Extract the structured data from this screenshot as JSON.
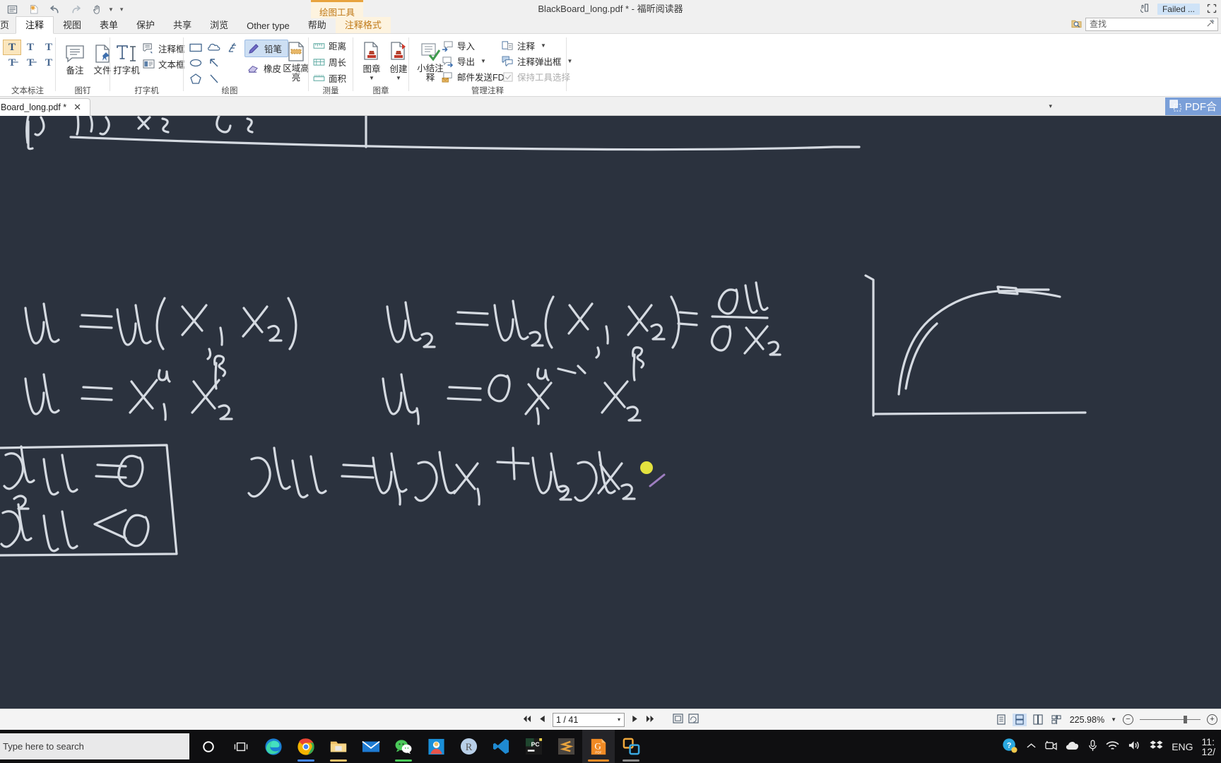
{
  "window": {
    "title": "BlackBoard_long.pdf * - 福昕阅读器",
    "contextual_tab": "绘图工具",
    "quick_access": [
      {
        "name": "save-icon",
        "glyph": "▤"
      },
      {
        "name": "new-document-icon",
        "glyph": "✳"
      },
      {
        "name": "undo-icon",
        "glyph": "↺"
      },
      {
        "name": "redo-icon",
        "glyph": "↻"
      },
      {
        "name": "hand-tool-icon",
        "glyph": "☞"
      }
    ],
    "top_right": {
      "hand_icon": "☝",
      "failed_label": "Failed ...",
      "restore_icon": "⛶"
    }
  },
  "tabs": [
    {
      "label": "页",
      "active": false
    },
    {
      "label": "注释",
      "active": true
    },
    {
      "label": "视图",
      "active": false
    },
    {
      "label": "表单",
      "active": false
    },
    {
      "label": "保护",
      "active": false
    },
    {
      "label": "共享",
      "active": false
    },
    {
      "label": "浏览",
      "active": false
    },
    {
      "label": "Other type",
      "active": false
    },
    {
      "label": "帮助",
      "active": false
    },
    {
      "label": "注释格式",
      "active": false,
      "contextual": true
    }
  ],
  "search": {
    "placeholder": "查找",
    "value": "",
    "icon": "search-folder-icon"
  },
  "ribbon": {
    "groups": [
      {
        "name": "text-markup",
        "label": "文本标注",
        "items": [
          {
            "name": "highlight-text-icon",
            "glyph": "T",
            "selected": true
          },
          {
            "name": "squiggly-text-icon",
            "glyph": "T"
          },
          {
            "name": "underline-text-icon",
            "glyph": "T"
          },
          {
            "name": "strikeout-text-icon",
            "glyph": "T"
          },
          {
            "name": "replace-text-icon",
            "glyph": "T"
          },
          {
            "name": "insert-text-icon",
            "glyph": "T"
          }
        ]
      },
      {
        "name": "pin",
        "label": "图钉",
        "buttons": [
          {
            "name": "note-button",
            "label": "备注"
          },
          {
            "name": "file-attach-button",
            "label": "文件"
          }
        ]
      },
      {
        "name": "typewriter",
        "label": "打字机",
        "buttons": [
          {
            "name": "typewriter-button",
            "label": "打字机"
          }
        ],
        "small_items": [
          {
            "name": "callout-button",
            "label": "注释框"
          },
          {
            "name": "textbox-button",
            "label": "文本框"
          }
        ]
      },
      {
        "name": "drawing",
        "label": "绘图",
        "shapes": [
          {
            "name": "rectangle-shape-icon",
            "glyph": "▭"
          },
          {
            "name": "cloud-shape-icon",
            "glyph": "☁"
          },
          {
            "name": "polyline-shape-icon",
            "glyph": "𝅻"
          },
          {
            "name": "ellipse-shape-icon",
            "glyph": "⬭"
          },
          {
            "name": "arrow-shape-icon",
            "glyph": "↖"
          },
          {
            "name": "polygon-shape-icon",
            "glyph": "⬠"
          },
          {
            "name": "line-shape-icon",
            "glyph": "╲"
          }
        ],
        "pen_tools": [
          {
            "name": "pencil-tool",
            "label": "铅笔",
            "selected": true
          },
          {
            "name": "eraser-tool",
            "label": "橡皮",
            "selected": false
          }
        ],
        "area_highlight": {
          "name": "area-highlight-button",
          "label": "区域高亮"
        }
      },
      {
        "name": "measure",
        "label": "测量",
        "items": [
          {
            "name": "distance-measure-button",
            "label": "距离"
          },
          {
            "name": "perimeter-measure-button",
            "label": "周长"
          },
          {
            "name": "area-measure-button",
            "label": "面积"
          }
        ]
      },
      {
        "name": "stamp",
        "label": "图章",
        "buttons": [
          {
            "name": "stamp-button",
            "label": "图章"
          },
          {
            "name": "create-stamp-button",
            "label": "创建"
          }
        ]
      },
      {
        "name": "manage-annotations",
        "label": "管理注释",
        "summary_button": {
          "name": "summarize-annotations-button",
          "label": "小结注释"
        },
        "items": [
          {
            "name": "import-annotations-button",
            "label": "导入"
          },
          {
            "name": "export-annotations-button",
            "label": "导出"
          },
          {
            "name": "mail-send-fdf-button",
            "label": "邮件发送FDF"
          },
          {
            "name": "annotation-list-button",
            "label": "注释"
          },
          {
            "name": "annotation-popup-button",
            "label": "注释弹出框"
          },
          {
            "name": "keep-tool-selected-checkbox",
            "label": "保持工具选择",
            "disabled": true,
            "checked": true
          }
        ]
      }
    ]
  },
  "document_tabbar": {
    "tab_label": "Board_long.pdf *",
    "close_icon": "✕",
    "dropdown_icon": "▾",
    "pdf_combine_label": "PDF合",
    "pdf_combine_icon": "combine-pdf-icon"
  },
  "page_view": {
    "background_color": "#2b323e",
    "ink_color": "#d9dde3",
    "cursor_color": "#e3e23f",
    "handwriting": [
      "u = u( x₁ , x₂ )",
      "u = x₁^α x₂^β",
      "u₂ = u₂( x₁ , x₂ ) = ∂u/∂x₂",
      "u₁ = α x₁^(α-1) x₂^β",
      "du = u₁ dx₁ + u₂ dx₂",
      "du = 0",
      "d²u < 0"
    ]
  },
  "status_bar": {
    "first_page_icon": "⏮",
    "prev_page_icon": "◀",
    "page_value": "1 / 41",
    "page_dropdown_icon": "▾",
    "next_page_icon": "▶",
    "last_page_icon": "⏭",
    "extra_icons": [
      "fit-page-icon",
      "rotate-view-icon"
    ],
    "view_modes": [
      {
        "name": "single-page-view",
        "selected": false
      },
      {
        "name": "continuous-page-view",
        "selected": true
      },
      {
        "name": "two-page-view",
        "selected": false
      },
      {
        "name": "two-page-continuous-view",
        "selected": false
      }
    ],
    "zoom_label": "225.98%",
    "zoom_out_icon": "−",
    "zoom_in_icon": "+"
  },
  "taskbar": {
    "search_placeholder": "Type here to search",
    "apps": [
      {
        "name": "cortana-icon",
        "glyph": "◯",
        "color": "#ffffff"
      },
      {
        "name": "task-view-icon",
        "glyph": "❐",
        "color": "#ffffff"
      },
      {
        "name": "microsoft-edge-icon",
        "glyph": "",
        "color": "#2d8ad8",
        "running": true
      },
      {
        "name": "google-chrome-icon",
        "glyph": "",
        "color": "#4285f4",
        "running": true
      },
      {
        "name": "file-explorer-icon",
        "glyph": "",
        "color": "#f6c453",
        "running": true
      },
      {
        "name": "mail-icon",
        "glyph": "✉",
        "color": "#1e7ad1"
      },
      {
        "name": "wechat-icon",
        "glyph": "",
        "color": "#4ac959",
        "running": true
      },
      {
        "name": "photos-icon",
        "glyph": "",
        "color": "#1a8fd8"
      },
      {
        "name": "rstudio-icon",
        "glyph": "R",
        "color": "#9dbbe0"
      },
      {
        "name": "vs-code-icon",
        "glyph": "",
        "color": "#1f8ad2"
      },
      {
        "name": "pycharm-icon",
        "glyph": "PC",
        "color": "#1a1a1a"
      },
      {
        "name": "sublime-text-icon",
        "glyph": "S",
        "color": "#e8a33d"
      },
      {
        "name": "foxit-reader-icon",
        "glyph": "G",
        "color": "#f08a24",
        "active": true,
        "running": true
      },
      {
        "name": "vmware-icon",
        "glyph": "❏",
        "color": "#f0a83c",
        "running": true
      }
    ],
    "tray": [
      {
        "name": "help-support-icon",
        "glyph": "?"
      },
      {
        "name": "show-hidden-icons-chevron",
        "glyph": "⌃"
      },
      {
        "name": "camera-icon",
        "glyph": "🎥"
      },
      {
        "name": "onedrive-icon",
        "glyph": "☁"
      },
      {
        "name": "microphone-icon",
        "glyph": "🎤"
      },
      {
        "name": "wifi-icon",
        "glyph": "📶"
      },
      {
        "name": "volume-icon",
        "glyph": "🔊"
      },
      {
        "name": "dropbox-icon",
        "glyph": "❖"
      },
      {
        "name": "language-indicator",
        "glyph": "ENG"
      }
    ],
    "clock_time": "11:",
    "clock_date": "12/"
  }
}
